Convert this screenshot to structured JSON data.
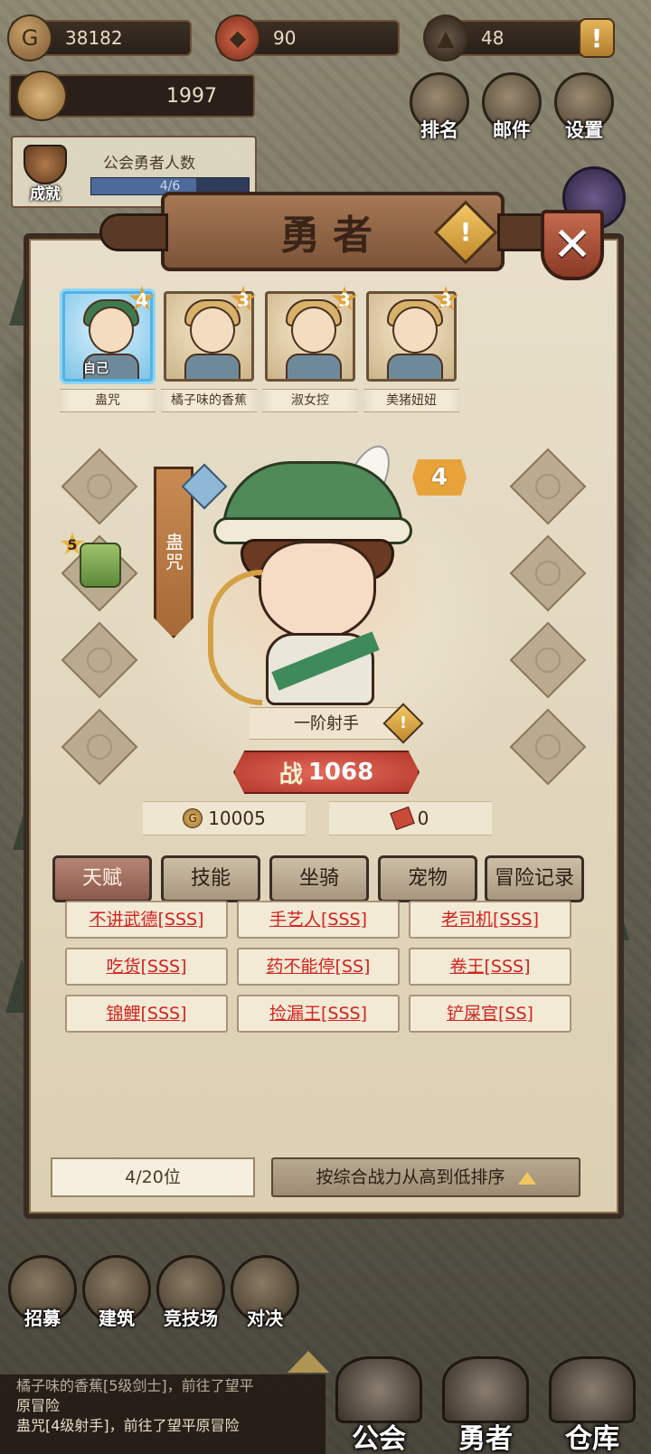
{
  "resources": {
    "gold": "38182",
    "honor": "90",
    "stone": "48",
    "alert": "!"
  },
  "guild": {
    "score": "1997",
    "members_label": "公会勇者人数",
    "members_value": "4/6",
    "members_fraction": 0.667
  },
  "achievement_label": "成就",
  "top_buttons": {
    "rank": "排名",
    "mail": "邮件",
    "settings": "设置"
  },
  "dialog": {
    "title": "勇者",
    "info": "!",
    "close": "✕"
  },
  "heroes": [
    {
      "name": "蛊咒",
      "stars": "4",
      "active": true,
      "tag": "自己"
    },
    {
      "name": "橘子味的香蕉",
      "stars": "3",
      "active": false
    },
    {
      "name": "淑女控",
      "stars": "3",
      "active": false
    },
    {
      "name": "美猪妞妞",
      "stars": "3",
      "active": false
    }
  ],
  "selected": {
    "name": "蛊咒",
    "level": "4",
    "equip_stars": "5",
    "class": "一阶射手",
    "class_info": "!",
    "power_label": "战",
    "power": "1068",
    "gold_cost": "10005",
    "ticket_cost": "0",
    "coin_glyph": "G"
  },
  "tabs": [
    "天赋",
    "技能",
    "坐骑",
    "宠物",
    "冒险记录"
  ],
  "talents": [
    "不讲武德[SSS]",
    "手艺人[SSS]",
    "老司机[SSS]",
    "吃货[SSS]",
    "药不能停[SS]",
    "卷王[SSS]",
    "锦鲤[SSS]",
    "捡漏王[SSS]",
    "铲屎官[SS]"
  ],
  "footer": {
    "roster": "4/20位",
    "sort": "按综合战力从高到低排序"
  },
  "bottom_nav": [
    "招募",
    "建筑",
    "竞技场",
    "对决"
  ],
  "log": [
    "橘子味的香蕉[5级剑士]，前往了望平",
    "原冒险",
    "蛊咒[4级射手]，前往了望平原冒险"
  ],
  "main_tabs": [
    "公会",
    "勇者",
    "仓库"
  ],
  "colors": {
    "parchment": "#e8dfca",
    "active_tab": "#8a5a4c",
    "talent_text": "#d2221e",
    "power_red": "#b2382c",
    "selected_border": "#4fb3e6"
  }
}
